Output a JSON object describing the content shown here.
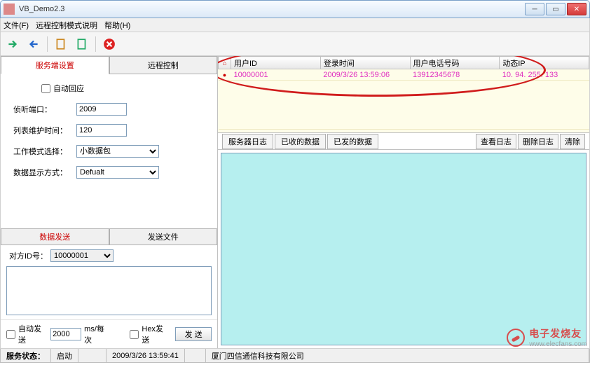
{
  "window": {
    "title": "VB_Demo2.3"
  },
  "menu": {
    "file": "文件(F)",
    "remote": "远程控制模式说明",
    "help": "帮助(H)"
  },
  "lefttabs": {
    "server": "服务端设置",
    "remote": "远程控制"
  },
  "settings": {
    "auto_reply_label": "自动回应",
    "listen_port_label": "侦听端口：",
    "listen_port_value": "2009",
    "list_maint_label": "列表维护时间：",
    "list_maint_value": "120",
    "work_mode_label": "工作模式选择：",
    "work_mode_value": "小数据包",
    "display_label": "数据显示方式：",
    "display_value": "Defualt"
  },
  "sendtabs": {
    "data": "数据发送",
    "file": "发送文件"
  },
  "send": {
    "target_label": "对方ID号：",
    "target_value": "10000001",
    "auto_send_label": "自动发送",
    "interval_value": "2000",
    "interval_unit": "ms/每次",
    "hex_label": "Hex发送",
    "send_button": "发 送"
  },
  "grid": {
    "headers": {
      "id": "用户ID",
      "time": "登录时间",
      "phone": "用户电话号码",
      "ip": "动态IP"
    },
    "rows": [
      {
        "id": "10000001",
        "time": "2009/3/26 13:59:06",
        "phone": "13912345678",
        "ip": "10. 94. 255. 133"
      }
    ]
  },
  "logtabs": {
    "server": "服务器日志",
    "recv": "已收的数据",
    "sent": "已发的数据",
    "view": "查看日志",
    "del": "删除日志",
    "clear": "清除"
  },
  "status": {
    "label": "服务状态：",
    "state": "启动",
    "datetime": "2009/3/26  13:59:41",
    "company": "厦门四信通信科技有限公司"
  },
  "watermark": {
    "brand": "电子发烧友",
    "url": "www.elecfans.com"
  }
}
